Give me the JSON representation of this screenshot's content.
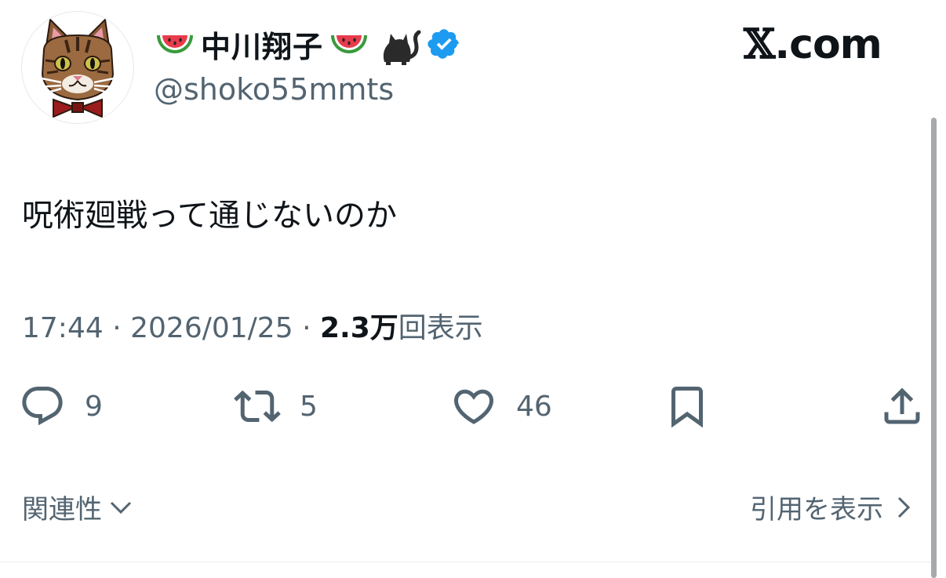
{
  "author": {
    "display_name": "中川翔子",
    "handle": "@shoko55mmts",
    "verified": true,
    "name_emojis": [
      "watermelon-icon",
      "watermelon-icon",
      "black-cat-icon"
    ],
    "verified_color": "#1d9bf0"
  },
  "brand": {
    "label": ".com",
    "glyph": "𝕏"
  },
  "tweet": {
    "text": "呪術廻戦って通じないのか",
    "time": "17:44",
    "separator": "·",
    "date": "2026/01/25",
    "views_count": "2.3万",
    "views_label": "回表示"
  },
  "actions": {
    "reply_count": "9",
    "retweet_count": "5",
    "like_count": "46"
  },
  "footer": {
    "related_label": "関連性",
    "quote_label": "引用を表示"
  },
  "colors": {
    "text_primary": "#0f1419",
    "text_secondary": "#536471",
    "verified_blue": "#1d9bf0",
    "watermelon_red": "#e83b4b",
    "watermelon_green": "#3a9a3c"
  }
}
